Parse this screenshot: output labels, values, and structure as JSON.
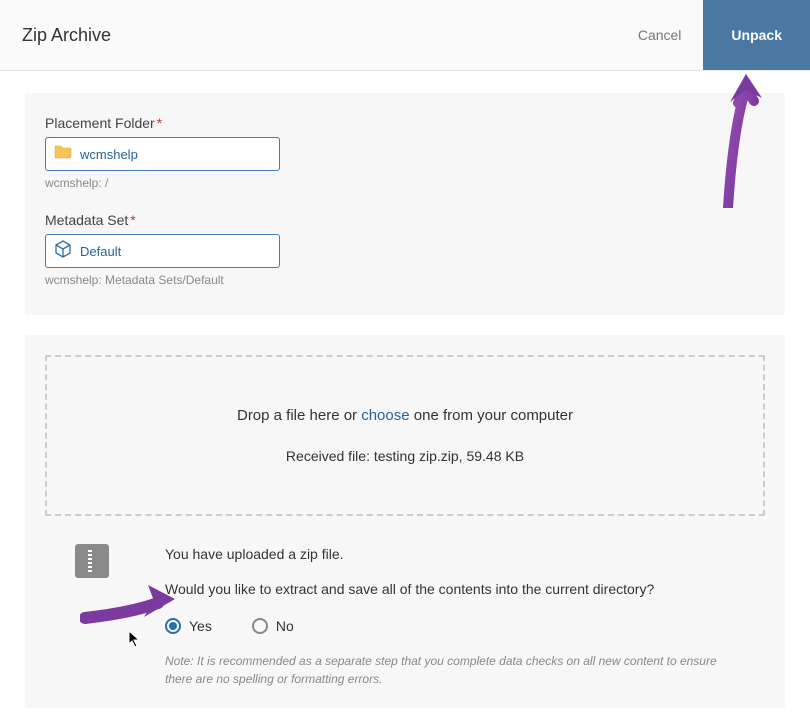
{
  "header": {
    "title": "Zip Archive",
    "cancel_label": "Cancel",
    "unpack_label": "Unpack"
  },
  "placement": {
    "label": "Placement Folder",
    "value": "wcmshelp",
    "helper": "wcmshelp: /"
  },
  "metadata": {
    "label": "Metadata Set",
    "value": "Default",
    "helper": "wcmshelp: Metadata Sets/Default"
  },
  "dropzone": {
    "text_before": "Drop a file here or ",
    "choose_label": "choose",
    "text_after": " one from your computer",
    "received_prefix": "Received file: ",
    "received_file": "testing zip.zip, 59.48 KB"
  },
  "zip": {
    "uploaded_msg": "You have uploaded a zip file.",
    "extract_question": "Would you like to extract and save all of the contents into the current directory?",
    "options": {
      "yes": "Yes",
      "no": "No"
    },
    "note": "Note: It is recommended as a separate step that you complete data checks on all new content to ensure there are no spelling or formatting errors."
  }
}
